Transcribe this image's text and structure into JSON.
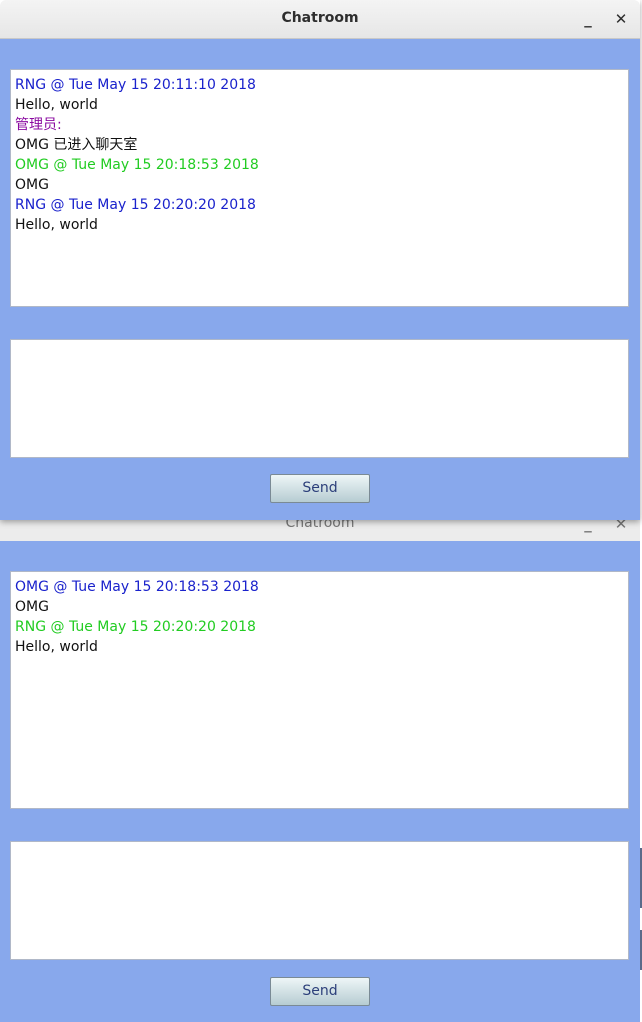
{
  "windows": [
    {
      "title": "Chatroom",
      "minimize_symbol": "_",
      "close_symbol": "✕",
      "messages": [
        {
          "text": "RNG @ Tue May 15 20:11:10 2018",
          "color": "blue"
        },
        {
          "text": "Hello, world",
          "color": "black"
        },
        {
          "text": "管理员:",
          "color": "purple"
        },
        {
          "text": "OMG 已进入聊天室",
          "color": "black"
        },
        {
          "text": "OMG @ Tue May 15 20:18:53 2018",
          "color": "green"
        },
        {
          "text": "OMG",
          "color": "black"
        },
        {
          "text": "RNG @ Tue May 15 20:20:20 2018",
          "color": "blue"
        },
        {
          "text": "Hello, world",
          "color": "black"
        }
      ],
      "input_value": "",
      "send_label": "Send"
    },
    {
      "title": "Chatroom",
      "minimize_symbol": "_",
      "close_symbol": "✕",
      "messages": [
        {
          "text": "OMG @ Tue May 15 20:18:53 2018",
          "color": "blue"
        },
        {
          "text": "OMG",
          "color": "black"
        },
        {
          "text": "RNG @ Tue May 15 20:20:20 2018",
          "color": "green"
        },
        {
          "text": "Hello, world",
          "color": "black"
        }
      ],
      "input_value": "",
      "send_label": "Send"
    }
  ],
  "colors": {
    "window_background": "#88a8ec",
    "blue_text": "#1a22cc",
    "green_text": "#22cc22",
    "purple_text": "#8a0aa0"
  }
}
